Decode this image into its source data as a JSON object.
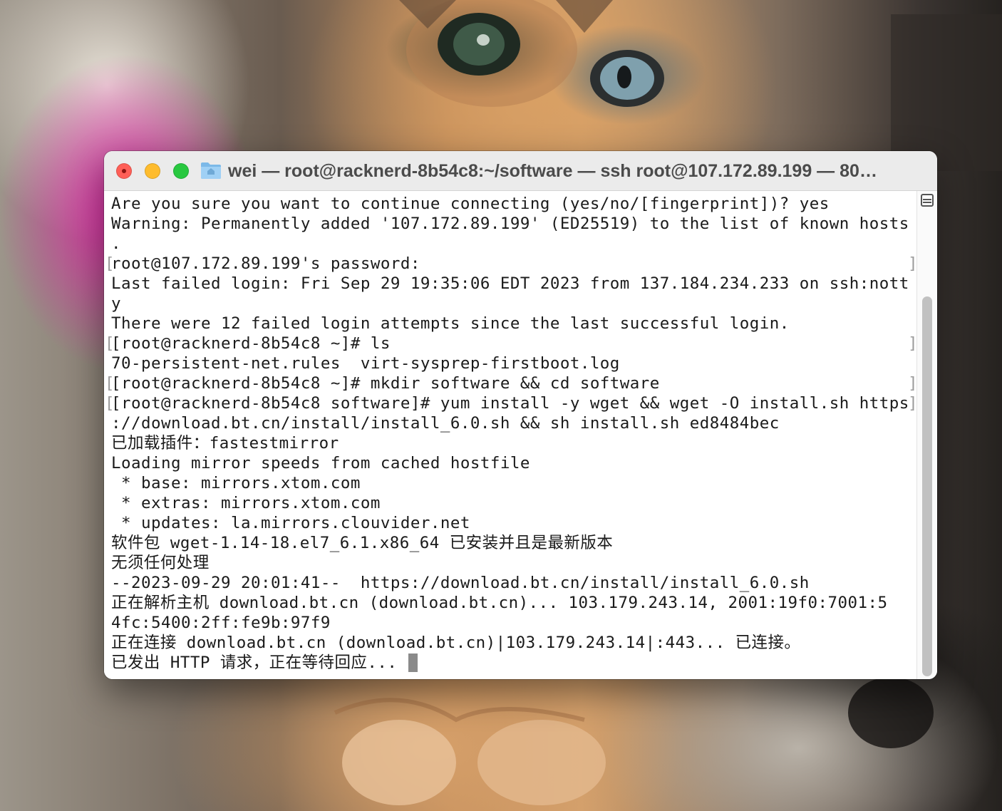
{
  "window": {
    "title": "wei — root@racknerd-8b54c8:~/software — ssh root@107.172.89.199 — 80…"
  },
  "terminal": {
    "lines": [
      "Are you sure you want to continue connecting (yes/no/[fingerprint])? yes",
      "Warning: Permanently added '107.172.89.199' (ED25519) to the list of known hosts",
      ".",
      "root@107.172.89.199's password:",
      "Last failed login: Fri Sep 29 19:35:06 EDT 2023 from 137.184.234.233 on ssh:nott",
      "y",
      "There were 12 failed login attempts since the last successful login.",
      "[root@racknerd-8b54c8 ~]# ls",
      "70-persistent-net.rules  virt-sysprep-firstboot.log",
      "[root@racknerd-8b54c8 ~]# mkdir software && cd software",
      "[root@racknerd-8b54c8 software]# yum install -y wget && wget -O install.sh https",
      "://download.bt.cn/install/install_6.0.sh && sh install.sh ed8484bec",
      "已加载插件：fastestmirror",
      "Loading mirror speeds from cached hostfile",
      " * base: mirrors.xtom.com",
      " * extras: mirrors.xtom.com",
      " * updates: la.mirrors.clouvider.net",
      "软件包 wget-1.14-18.el7_6.1.x86_64 已安装并且是最新版本",
      "无须任何处理",
      "--2023-09-29 20:01:41--  https://download.bt.cn/install/install_6.0.sh",
      "正在解析主机 download.bt.cn (download.bt.cn)... 103.179.243.14, 2001:19f0:7001:5",
      "4fc:5400:2ff:fe9b:97f9",
      "正在连接 download.bt.cn (download.bt.cn)|103.179.243.14|:443... 已连接。",
      "已发出 HTTP 请求，正在等待回应... "
    ]
  }
}
